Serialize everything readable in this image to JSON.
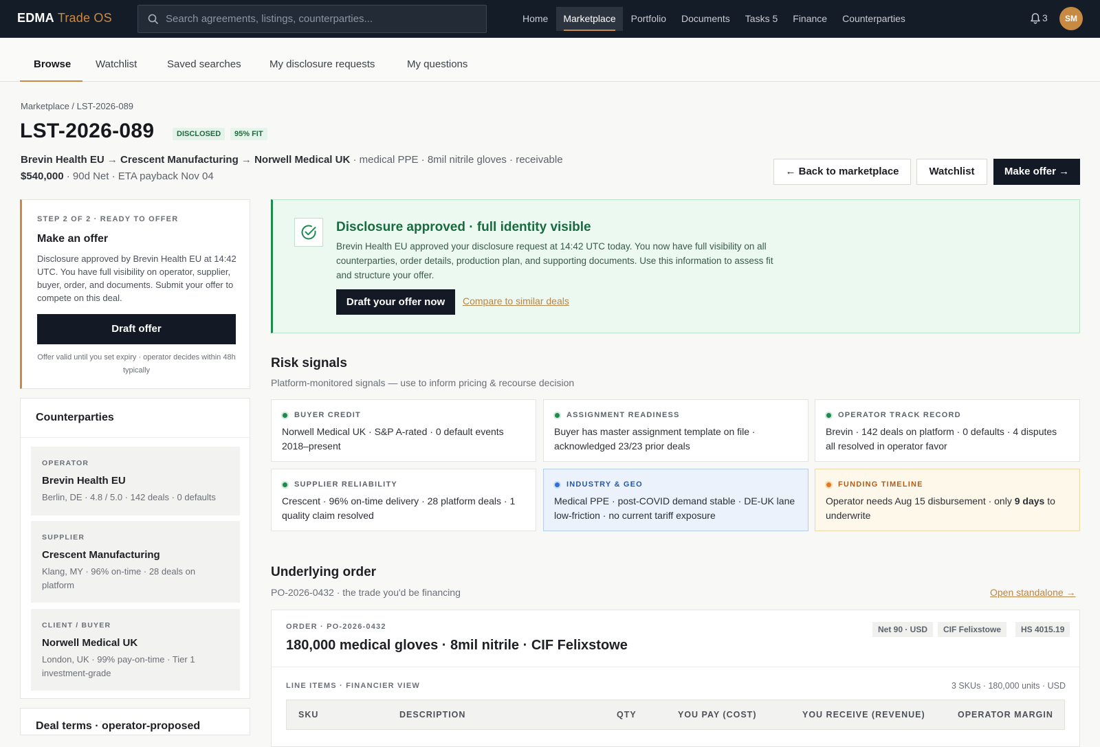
{
  "app": {
    "brand": "EDMA",
    "product": "Trade OS"
  },
  "search": {
    "placeholder": "Search agreements, listings, counterparties..."
  },
  "nav": [
    {
      "label": "Home"
    },
    {
      "label": "Marketplace",
      "active": true
    },
    {
      "label": "Portfolio"
    },
    {
      "label": "Documents"
    },
    {
      "label": "Tasks 5"
    },
    {
      "label": "Finance"
    },
    {
      "label": "Counterparties"
    }
  ],
  "notifications": {
    "count": "3"
  },
  "user": {
    "initials": "SM"
  },
  "subnav": [
    {
      "label": "Browse",
      "active": true
    },
    {
      "label": "Watchlist"
    },
    {
      "label": "Saved searches"
    },
    {
      "label": "My disclosure requests"
    },
    {
      "label": "My questions"
    }
  ],
  "breadcrumb": "Marketplace / LST-2026-089",
  "listing": {
    "id": "LST-2026-089",
    "badges": [
      "DISCLOSED",
      "95% FIT"
    ],
    "operator": "Brevin Health EU",
    "supplier": "Crescent Manufacturing",
    "buyer": "Norwell Medical UK",
    "arrow": "→",
    "descriptor": " · medical PPE · 8mil nitrile gloves · receivable",
    "amount": "$540,000",
    "terms": " · 90d Net · ETA payback Nov 04"
  },
  "actions": {
    "back": "← Back to marketplace",
    "watchlist": "Watchlist",
    "make_offer": "Make offer →"
  },
  "offer_card": {
    "step": "STEP 2 OF 2 · READY TO OFFER",
    "title": "Make an offer",
    "body": "Disclosure approved by Brevin Health EU at 14:42 UTC. You have full visibility on operator, supplier, buyer, order, and documents. Submit your offer to compete on this deal.",
    "button": "Draft offer",
    "note": "Offer valid until you set expiry · operator decides within 48h typically"
  },
  "counterparties": {
    "title": "Counterparties",
    "items": [
      {
        "role": "OPERATOR",
        "name": "Brevin Health EU",
        "meta": "Berlin, DE · 4.8 / 5.0 · 142 deals · 0 defaults"
      },
      {
        "role": "SUPPLIER",
        "name": "Crescent Manufacturing",
        "meta": "Klang, MY · 96% on-time · 28 deals on platform"
      },
      {
        "role": "CLIENT / BUYER",
        "name": "Norwell Medical UK",
        "meta": "London, UK · 99% pay-on-time · Tier 1 investment-grade"
      }
    ]
  },
  "deal_terms": {
    "title": "Deal terms · operator-proposed"
  },
  "approval": {
    "title": "Disclosure approved · full identity visible",
    "body": "Brevin Health EU approved your disclosure request at 14:42 UTC today. You now have full visibility on all counterparties, order details, production plan, and supporting documents. Use this information to assess fit and structure your offer.",
    "button": "Draft your offer now",
    "link": "Compare to similar deals"
  },
  "risk": {
    "title": "Risk signals",
    "subtitle": "Platform-monitored signals — use to inform pricing & recourse decision",
    "signals": [
      {
        "label": "BUYER CREDIT",
        "text": "Norwell Medical UK · S&P A-rated · 0 default events 2018–present",
        "tone": "green"
      },
      {
        "label": "ASSIGNMENT READINESS",
        "text": "Buyer has master assignment template on file · acknowledged 23/23 prior deals",
        "tone": "green"
      },
      {
        "label": "OPERATOR TRACK RECORD",
        "text": "Brevin · 142 deals on platform · 0 defaults · 4 disputes all resolved in operator favor",
        "tone": "green"
      },
      {
        "label": "SUPPLIER RELIABILITY",
        "text": "Crescent · 96% on-time delivery · 28 platform deals · 1 quality claim resolved",
        "tone": "green"
      },
      {
        "label": "INDUSTRY & GEO",
        "text": "Medical PPE · post-COVID demand stable · DE-UK lane low-friction · no current tariff exposure",
        "tone": "blue"
      },
      {
        "label": "FUNDING TIMELINE",
        "text_pre": "Operator needs Aug 15 disbursement · only ",
        "text_bold": "9 days",
        "text_post": " to underwrite",
        "tone": "amber"
      }
    ],
    "colors": {
      "green": "#1e8a4f",
      "blue": "#2f6fd6",
      "amber": "#e07a1f"
    }
  },
  "order": {
    "title": "Underlying order",
    "subtitle": "PO-2026-0432 · the trade you'd be financing",
    "open_link": "Open standalone →",
    "kicker": "ORDER · PO-2026-0432",
    "headline": "180,000 medical gloves · 8mil nitrile · CIF Felixstowe",
    "tags": [
      "Net 90 · USD",
      "CIF Felixstowe",
      "HS 4015.19"
    ],
    "line_items_label": "LINE ITEMS · FINANCIER VIEW",
    "line_items_meta": "3 SKUs · 180,000 units · USD",
    "columns": [
      "SKU",
      "DESCRIPTION",
      "QTY",
      "YOU PAY (COST)",
      "YOU RECEIVE (REVENUE)",
      "OPERATOR MARGIN"
    ]
  }
}
